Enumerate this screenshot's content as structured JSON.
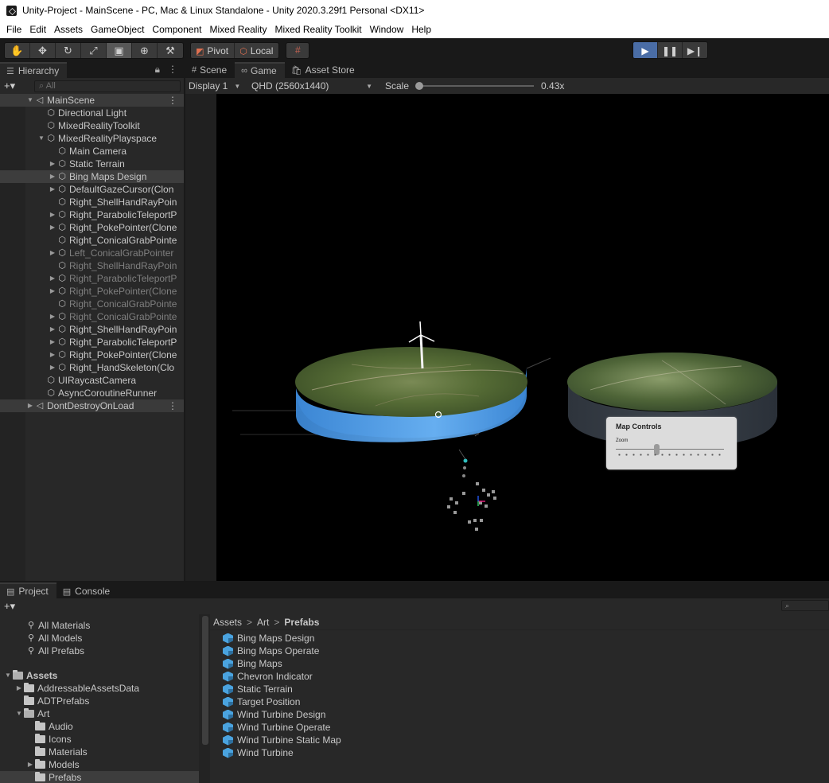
{
  "window": {
    "title": "Unity-Project - MainScene - PC, Mac & Linux Standalone - Unity 2020.3.29f1 Personal <DX11>"
  },
  "menu": [
    "File",
    "Edit",
    "Assets",
    "GameObject",
    "Component",
    "Mixed Reality",
    "Mixed Reality Toolkit",
    "Window",
    "Help"
  ],
  "toolbar": {
    "tools": [
      "hand-tool",
      "move-tool",
      "rotate-tool",
      "scale-tool",
      "rect-tool",
      "transform-tool",
      "custom-tool"
    ],
    "active_tool_index": 4,
    "pivot_label": "Pivot",
    "local_label": "Local",
    "play_state": "playing"
  },
  "hierarchy": {
    "tab_label": "Hierarchy",
    "search_placeholder": "All",
    "rows": [
      {
        "label": "MainScene",
        "indent": 0,
        "arrow": "open",
        "icon": "scene",
        "style": "scene",
        "menu": true
      },
      {
        "label": "Directional Light",
        "indent": 1,
        "arrow": "",
        "icon": "cube",
        "style": ""
      },
      {
        "label": "MixedRealityToolkit",
        "indent": 1,
        "arrow": "",
        "icon": "cube",
        "style": ""
      },
      {
        "label": "MixedRealityPlayspace",
        "indent": 1,
        "arrow": "open",
        "icon": "cube",
        "style": ""
      },
      {
        "label": "Main Camera",
        "indent": 2,
        "arrow": "",
        "icon": "cube",
        "style": ""
      },
      {
        "label": "Static Terrain",
        "indent": 2,
        "arrow": "closed",
        "icon": "cube",
        "style": ""
      },
      {
        "label": "Bing Maps Design",
        "indent": 2,
        "arrow": "closed",
        "icon": "cube",
        "style": "selected"
      },
      {
        "label": "DefaultGazeCursor(Clon",
        "indent": 2,
        "arrow": "closed",
        "icon": "cube",
        "style": ""
      },
      {
        "label": "Right_ShellHandRayPoin",
        "indent": 2,
        "arrow": "",
        "icon": "cube",
        "style": ""
      },
      {
        "label": "Right_ParabolicTeleportP",
        "indent": 2,
        "arrow": "closed",
        "icon": "cube",
        "style": ""
      },
      {
        "label": "Right_PokePointer(Clone",
        "indent": 2,
        "arrow": "closed",
        "icon": "cube",
        "style": ""
      },
      {
        "label": "Right_ConicalGrabPointe",
        "indent": 2,
        "arrow": "",
        "icon": "cube",
        "style": ""
      },
      {
        "label": "Left_ConicalGrabPointer",
        "indent": 2,
        "arrow": "closed",
        "icon": "cube",
        "style": "dim"
      },
      {
        "label": "Right_ShellHandRayPoin",
        "indent": 2,
        "arrow": "",
        "icon": "cube",
        "style": "dim"
      },
      {
        "label": "Right_ParabolicTeleportP",
        "indent": 2,
        "arrow": "closed",
        "icon": "cube",
        "style": "dim"
      },
      {
        "label": "Right_PokePointer(Clone",
        "indent": 2,
        "arrow": "closed",
        "icon": "cube",
        "style": "dim"
      },
      {
        "label": "Right_ConicalGrabPointe",
        "indent": 2,
        "arrow": "",
        "icon": "cube",
        "style": "dim"
      },
      {
        "label": "Right_ConicalGrabPointe",
        "indent": 2,
        "arrow": "closed",
        "icon": "cube",
        "style": "dim"
      },
      {
        "label": "Right_ShellHandRayPoin",
        "indent": 2,
        "arrow": "closed",
        "icon": "cube",
        "style": ""
      },
      {
        "label": "Right_ParabolicTeleportP",
        "indent": 2,
        "arrow": "closed",
        "icon": "cube",
        "style": ""
      },
      {
        "label": "Right_PokePointer(Clone",
        "indent": 2,
        "arrow": "closed",
        "icon": "cube",
        "style": ""
      },
      {
        "label": "Right_HandSkeleton(Clo",
        "indent": 2,
        "arrow": "closed",
        "icon": "cube",
        "style": ""
      },
      {
        "label": "UIRaycastCamera",
        "indent": 1,
        "arrow": "",
        "icon": "cube",
        "style": ""
      },
      {
        "label": "AsyncCoroutineRunner",
        "indent": 1,
        "arrow": "",
        "icon": "cube",
        "style": ""
      },
      {
        "label": "DontDestroyOnLoad",
        "indent": 0,
        "arrow": "closed",
        "icon": "scene",
        "style": "scene",
        "menu": true
      }
    ]
  },
  "game": {
    "tabs": [
      {
        "label": "Scene",
        "icon": "#",
        "active": false
      },
      {
        "label": "Game",
        "icon": "∞",
        "active": true
      },
      {
        "label": "Asset Store",
        "icon": "🛍",
        "active": false
      }
    ],
    "display": "Display 1",
    "resolution": "QHD (2560x1440)",
    "scale_label": "Scale",
    "scale_value": "0.43x",
    "map_panel": {
      "title": "Map Controls",
      "zoom_label": "Zoom"
    }
  },
  "project": {
    "tabs": [
      {
        "label": "Project",
        "icon": "▤",
        "active": true
      },
      {
        "label": "Console",
        "icon": "▤",
        "active": false
      }
    ],
    "favorites": [
      "All Materials",
      "All Models",
      "All Prefabs"
    ],
    "tree": [
      {
        "label": "Assets",
        "indent": 0,
        "arrow": "open",
        "bold": true
      },
      {
        "label": "AddressableAssetsData",
        "indent": 1,
        "arrow": "closed"
      },
      {
        "label": "ADTPrefabs",
        "indent": 1,
        "arrow": ""
      },
      {
        "label": "Art",
        "indent": 1,
        "arrow": "open"
      },
      {
        "label": "Audio",
        "indent": 2,
        "arrow": ""
      },
      {
        "label": "Icons",
        "indent": 2,
        "arrow": ""
      },
      {
        "label": "Materials",
        "indent": 2,
        "arrow": ""
      },
      {
        "label": "Models",
        "indent": 2,
        "arrow": "closed"
      },
      {
        "label": "Prefabs",
        "indent": 2,
        "arrow": "",
        "selected": true
      }
    ],
    "breadcrumb": [
      "Assets",
      "Art",
      "Prefabs"
    ],
    "assets": [
      "Bing Maps Design",
      "Bing Maps Operate",
      "Bing Maps",
      "Chevron Indicator",
      "Static Terrain",
      "Target Position",
      "Wind Turbine Design",
      "Wind Turbine Operate",
      "Wind Turbine Static Map",
      "Wind Turbine"
    ]
  }
}
